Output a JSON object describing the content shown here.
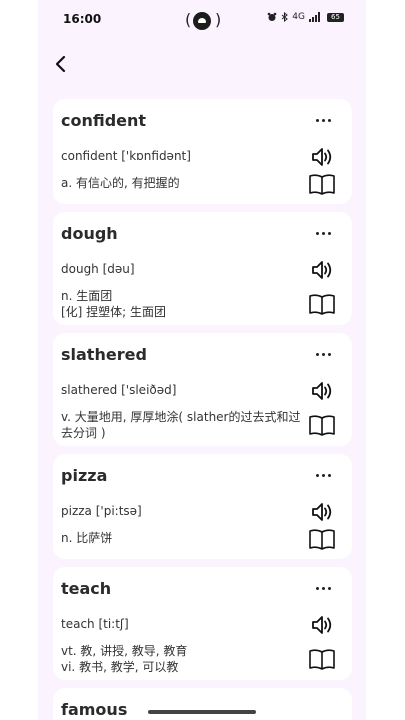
{
  "status_bar": {
    "time": "16:00",
    "network": "4G",
    "battery": "65"
  },
  "cards": [
    {
      "word": "confident",
      "phonetic": "confident ['kɒnfidənt]",
      "definition_lines": [
        "a. 有信心的, 有把握的"
      ]
    },
    {
      "word": "dough",
      "phonetic": "dough [dəu]",
      "definition_lines": [
        "n. 生面团",
        "[化] 捏塑体; 生面团"
      ]
    },
    {
      "word": "slathered",
      "phonetic": "slathered ['sleiðəd]",
      "definition_lines": [
        "v. 大量地用, 厚厚地涂( slather的过去式和过",
        "去分词 )"
      ]
    },
    {
      "word": "pizza",
      "phonetic": "pizza ['pi:tsə]",
      "definition_lines": [
        "n. 比萨饼"
      ]
    },
    {
      "word": "teach",
      "phonetic": "teach [ti:tʃ]",
      "definition_lines": [
        "vt. 教, 讲授, 教导, 教育",
        "vi. 教书, 教学, 可以教"
      ]
    },
    {
      "word": "famous",
      "phonetic": "",
      "definition_lines": []
    }
  ],
  "icons": {
    "back": "chevron-left-icon",
    "more": "more-horizontal-icon",
    "speaker": "speaker-icon",
    "dictionary": "open-book-icon"
  }
}
